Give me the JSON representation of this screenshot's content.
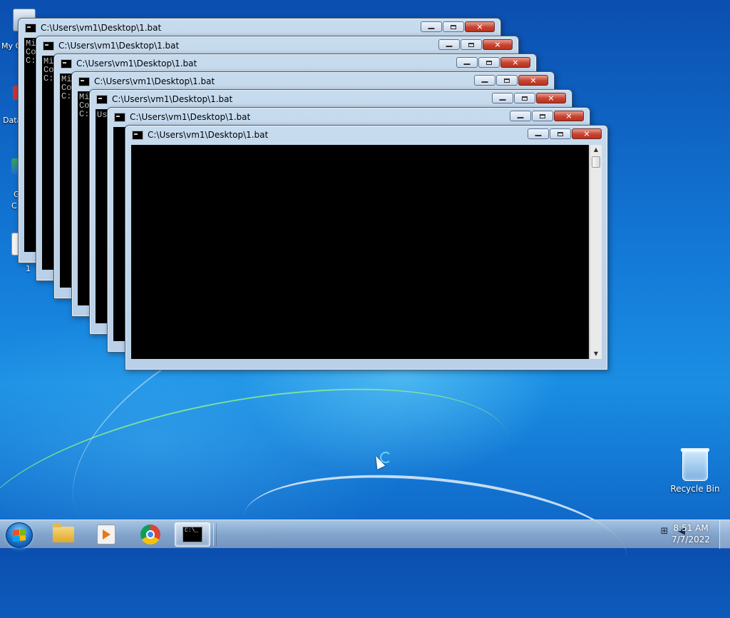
{
  "desktop": {
    "icons_left": [
      {
        "label": "My C"
      },
      {
        "label": "Data"
      },
      {
        "label": "G"
      },
      {
        "label": "C"
      },
      {
        "label": "1"
      }
    ],
    "recycle_bin": {
      "label": "Recycle Bin"
    }
  },
  "windows": [
    {
      "title": "C:\\Users\\vm1\\Desktop\\1.bat",
      "console_lines": [
        "Mi",
        "Co",
        "",
        "C:"
      ]
    },
    {
      "title": "C:\\Users\\vm1\\Desktop\\1.bat",
      "console_lines": [
        "Mi",
        "Co",
        "",
        "C:"
      ]
    },
    {
      "title": "C:\\Users\\vm1\\Desktop\\1.bat",
      "console_lines": [
        "Mi",
        "Co",
        "",
        "C:"
      ]
    },
    {
      "title": "C:\\Users\\vm1\\Desktop\\1.bat",
      "console_lines": [
        "Mi",
        "Co",
        "",
        "C:"
      ]
    },
    {
      "title": "C:\\Users\\vm1\\Desktop\\1.bat",
      "console_lines": [
        "",
        "",
        "Us"
      ]
    },
    {
      "title": "C:\\Users\\vm1\\Desktop\\1.bat",
      "console_lines": []
    },
    {
      "title": "C:\\Users\\vm1\\Desktop\\1.bat",
      "console_lines": []
    }
  ],
  "window_buttons": {
    "minimize": "",
    "maximize": "",
    "close": "✕"
  },
  "taskbar": {
    "start_label": "Start",
    "pinned": [
      {
        "name": "Windows Explorer"
      },
      {
        "name": "Windows Media Player"
      },
      {
        "name": "Google Chrome"
      },
      {
        "name": "Command Prompt"
      }
    ],
    "tray_icons": [
      "network-icon",
      "volume-icon"
    ],
    "clock": {
      "time": "8:51 AM",
      "date": "7/7/2022"
    }
  },
  "colors": {
    "console_bg": "#000000",
    "close_button": "#c7432f",
    "titlebar": "#c7dbee"
  }
}
